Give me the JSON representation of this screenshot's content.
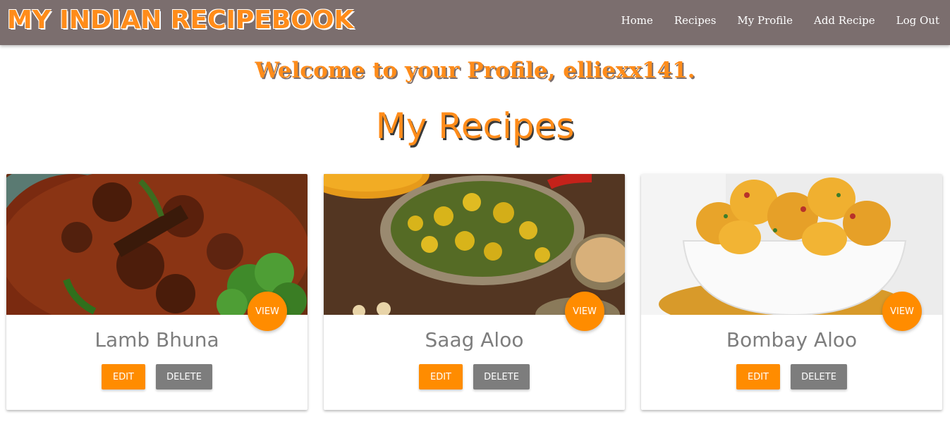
{
  "navbar": {
    "brand": "MY INDIAN RECIPEBOOK",
    "links": [
      "Home",
      "Recipes",
      "My Profile",
      "Add Recipe",
      "Log Out"
    ]
  },
  "profile": {
    "welcome": "Welcome to your Profile, elliexx141.",
    "section_title": "My Recipes"
  },
  "recipes": [
    {
      "title": "Lamb Bhuna",
      "image": "lamb-bhuna-photo",
      "view_label": "VIEW",
      "edit_label": "EDIT",
      "delete_label": "DELETE"
    },
    {
      "title": "Saag Aloo",
      "image": "saag-aloo-photo",
      "view_label": "VIEW",
      "edit_label": "EDIT",
      "delete_label": "DELETE"
    },
    {
      "title": "Bombay Aloo",
      "image": "bombay-aloo-photo",
      "view_label": "VIEW",
      "edit_label": "EDIT",
      "delete_label": "DELETE"
    }
  ],
  "colors": {
    "navbar_bg": "#7b6e6e",
    "accent": "#ff8c00",
    "secondary_button": "#7d7d7d",
    "card_title": "#7d7d7d"
  }
}
